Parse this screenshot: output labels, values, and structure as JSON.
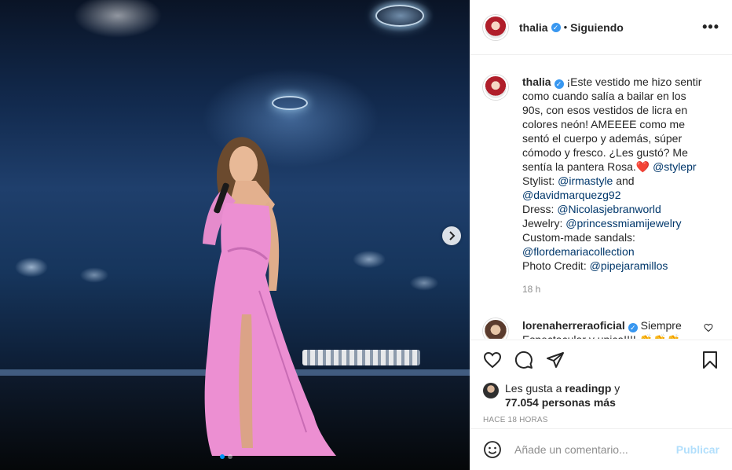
{
  "post": {
    "username": "thalia",
    "separator": "•",
    "follow_label": "Siguiendo",
    "more_label": "•••"
  },
  "caption": {
    "username": "thalia",
    "text_1": "¡Este vestido me hizo sentir como cuando salía a bailar en los 90s, con esos vestidos de licra en colores neón! AMEEEE como me sentó el cuerpo y además, súper cómodo y fresco. ¿Les gustó? Me sentía la pantera Rosa.",
    "heart_emoji": "❤️",
    "mention_stylepr": "@stylepr",
    "stylist_label": "Stylist:",
    "mention_irmastyle": "@irmastyle",
    "and_label": "and",
    "mention_davidmarquez": "@davidmarquezg92",
    "dress_label": "Dress:",
    "mention_nicolas": "@Nicolasjebranworld",
    "jewelry_label": "Jewelry:",
    "mention_princess": "@princessmiamijewelry",
    "sandals_label": "Custom-made sandals:",
    "mention_flor": "@flordemariacollection",
    "photo_label": "Photo Credit:",
    "mention_pipe": "@pipejaramillos",
    "time": "18 h"
  },
  "reply": {
    "username": "lorenaherreraoficial",
    "text": "Siempre Espectacular y unica!!!! 👏👏👏"
  },
  "likes": {
    "prefix": "Les gusta a",
    "user": "readingp",
    "conj": "y",
    "count": "77.054 personas más"
  },
  "posted_ago": "HACE 18 HORAS",
  "comment_box": {
    "placeholder": "Añade un comentario...",
    "publish_label": "Publicar"
  },
  "colors": {
    "link": "#00376b",
    "verified": "#3897f0",
    "publish_disabled": "#b2dffc",
    "carousel_active": "#0095f6"
  },
  "carousel": {
    "current": 1,
    "total": 2
  }
}
